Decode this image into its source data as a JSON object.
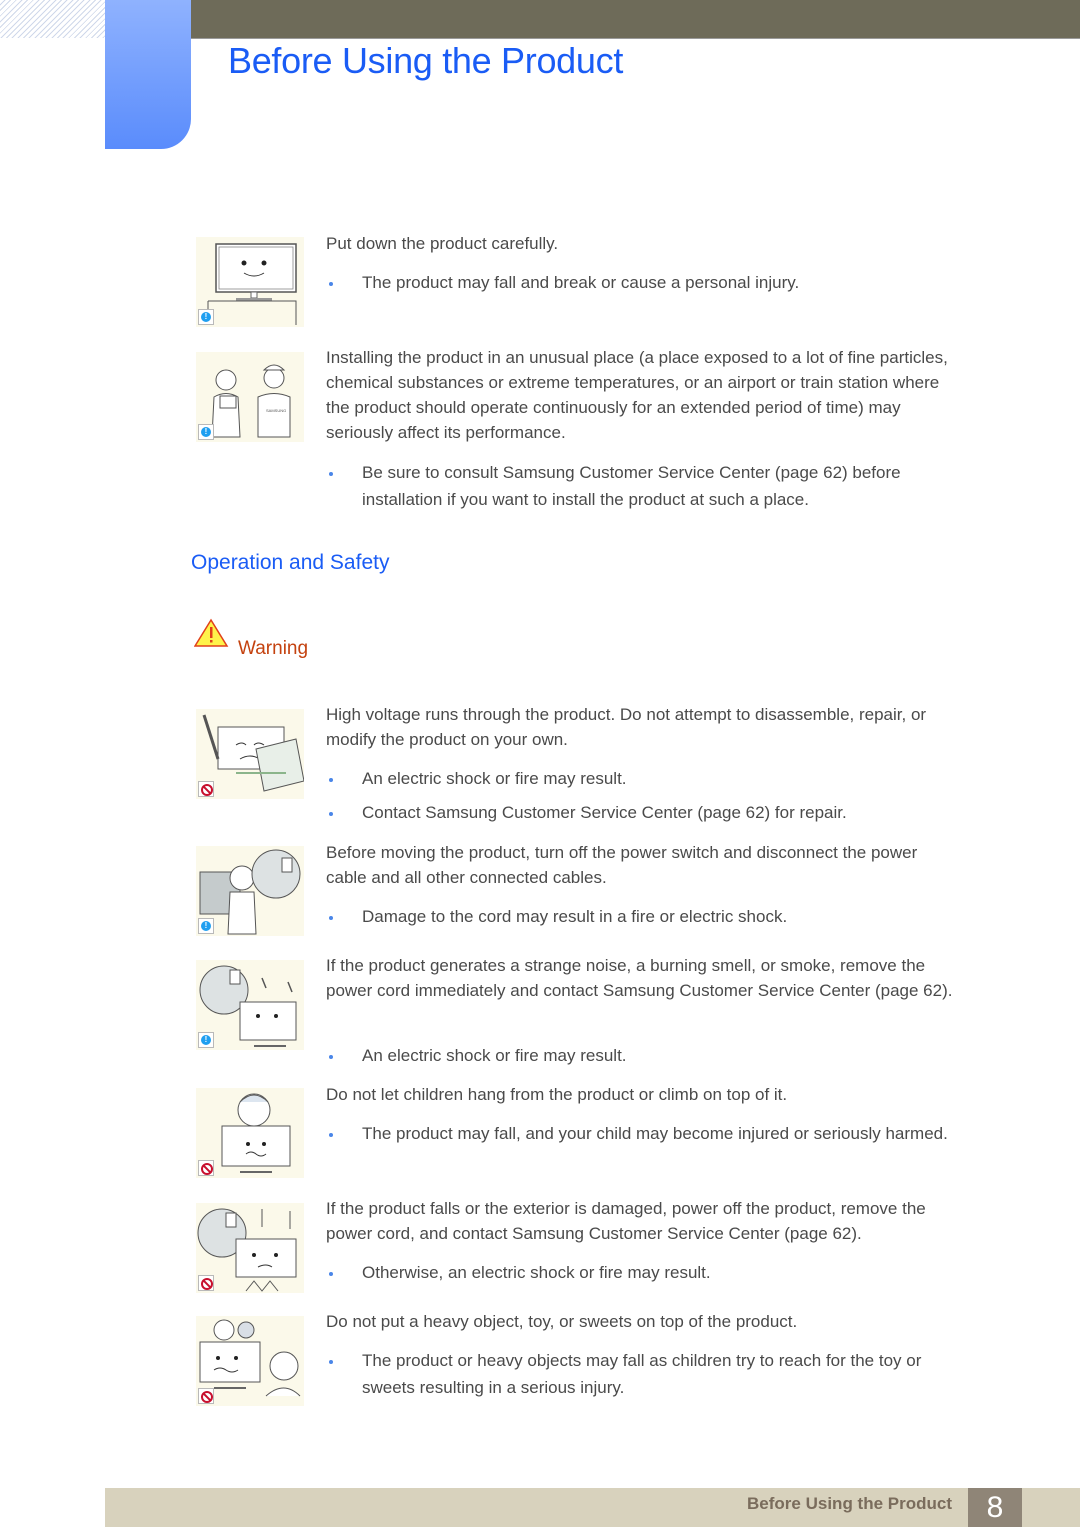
{
  "header": {
    "title": "Before Using the Product"
  },
  "sections": {
    "install": [
      {
        "icon": "info-icon",
        "illustration": "monitor-on-table-illustration",
        "text": "Put down the product carefully.",
        "bullets": [
          "The product may fall and break or cause a personal injury."
        ]
      },
      {
        "icon": "info-icon",
        "illustration": "customer-service-illustration",
        "text": "Installing the product in an unusual place (a place exposed to a lot of fine particles, chemical substances or extreme temperatures, or an airport or train station where the product should operate continuously for an extended period of time) may seriously affect its performance.",
        "bullets": [
          "Be sure to consult Samsung Customer Service Center (page 62) before installation if you want to install the product at such a place."
        ]
      }
    ],
    "operation": {
      "title": "Operation and Safety",
      "warning_label": "Warning",
      "items": [
        {
          "icon": "prohibit-icon",
          "illustration": "disassemble-illustration",
          "text": "High voltage runs through the product. Do not attempt to disassemble, repair, or modify the product on your own.",
          "bullets": [
            "An electric shock or fire may result.",
            "Contact Samsung Customer Service Center (page 62) for repair."
          ]
        },
        {
          "icon": "info-icon",
          "illustration": "unplug-before-moving-illustration",
          "text": "Before moving the product, turn off the power switch and disconnect the power cable and all other connected cables.",
          "bullets": [
            "Damage to the cord may result in a fire or electric shock."
          ]
        },
        {
          "icon": "info-icon",
          "illustration": "smoke-unplug-illustration",
          "text": "If the product generates a strange noise, a burning smell, or smoke, remove the power cord immediately and contact Samsung Customer Service Center (page 62).",
          "bullets": [
            "An electric shock or fire may result."
          ]
        },
        {
          "icon": "prohibit-icon",
          "illustration": "child-climbing-illustration",
          "text": "Do not let children hang from the product or climb on top of it.",
          "bullets": [
            "The product may fall, and your child may become injured or seriously harmed."
          ]
        },
        {
          "icon": "prohibit-icon",
          "illustration": "damaged-product-illustration",
          "text": "If the product falls or the exterior is damaged, power off the product, remove the power cord, and contact Samsung Customer Service Center (page 62).",
          "bullets": [
            "Otherwise, an electric shock or fire may result."
          ]
        },
        {
          "icon": "prohibit-icon",
          "illustration": "objects-on-top-illustration",
          "text": "Do not put a heavy object, toy, or sweets on top of the product.",
          "bullets": [
            "The product or heavy objects may fall as children try to reach for the toy or sweets resulting in a serious injury."
          ]
        }
      ]
    }
  },
  "footer": {
    "chapter": "Before Using the Product",
    "page_number": "8"
  },
  "colors": {
    "title_blue": "#1a5cf5",
    "warning_orange": "#c4420f",
    "top_bar": "#6e6b59",
    "footer_bar": "#d8d2bd",
    "page_box": "#8f8577",
    "bullet_blue": "#4a86e8"
  }
}
